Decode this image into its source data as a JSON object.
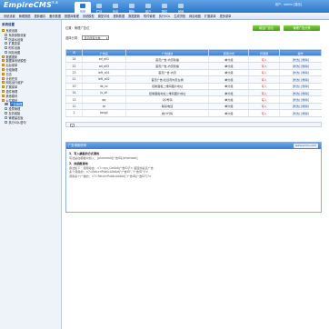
{
  "header": {
    "logo": "EmpireCMS",
    "version": "7.5",
    "user_line": "用户：admin [退出]",
    "tabs": [
      "系统",
      "栏目",
      "信息",
      "模板",
      "用户",
      "插件",
      "其他"
    ],
    "active_tab": 0
  },
  "subnav": [
    "系统设置",
    "管理数据",
    "更新缓存",
    "备份数据",
    "数据库管理",
    "系统模型",
    "模型字段",
    "更新数据",
    "数据更新",
    "附件管理",
    "执行SQL",
    "生成拼音",
    "网站地图",
    "扩展菜单",
    "更多菜单"
  ],
  "sidebar": {
    "title": "系统设置",
    "items": [
      {
        "label": "系统设置",
        "level": 0,
        "icon": "folder-icon"
      },
      {
        "label": "系统参数设置",
        "level": 1,
        "icon": "doc-icon"
      },
      {
        "label": "防灌水设置",
        "level": 1,
        "icon": "doc-icon"
      },
      {
        "label": "扩展变量",
        "level": 1,
        "icon": "doc-icon"
      },
      {
        "label": "附件设置",
        "level": 1,
        "icon": "doc-icon"
      },
      {
        "label": "网站地图",
        "level": 1,
        "icon": "doc-icon"
      },
      {
        "label": "数据更新",
        "level": 0,
        "icon": "folder-icon"
      },
      {
        "label": "数据库系统模型",
        "level": 0,
        "icon": "folder-icon"
      },
      {
        "label": "后台菜单",
        "level": 0,
        "icon": "folder-icon"
      },
      {
        "label": "分组管理",
        "level": 0,
        "icon": "folder-icon"
      },
      {
        "label": "日志",
        "level": 0,
        "icon": "folder-icon"
      },
      {
        "label": "计划任务",
        "level": 0,
        "icon": "folder-icon"
      },
      {
        "label": "网站运行维护",
        "level": 0,
        "icon": "folder-icon"
      },
      {
        "label": "扩展菜单",
        "level": 0,
        "icon": "folder-icon"
      },
      {
        "label": "插件管理",
        "level": 0,
        "icon": "folder-icon"
      },
      {
        "label": "其他模块",
        "level": 0,
        "icon": "folder-icon"
      },
      {
        "label": "公共模块",
        "level": 0,
        "icon": "folder-icon"
      },
      {
        "label": "广告管理",
        "level": 1,
        "icon": "doc-icon",
        "selected": true
      },
      {
        "label": "投票管理",
        "level": 1,
        "icon": "doc-icon"
      },
      {
        "label": "友情链接",
        "level": 1,
        "icon": "doc-icon"
      },
      {
        "label": "管理留言板",
        "level": 1,
        "icon": "doc-icon"
      },
      {
        "label": "执行SQL语句",
        "level": 1,
        "icon": "doc-icon"
      }
    ]
  },
  "page": {
    "breadcrumb": "位置：管理广告位",
    "add_button": "增加广告位",
    "manage_button": "管理广告分类",
    "filter_label": "选择分类：",
    "filter_value": "显示所有分类"
  },
  "table": {
    "headers": [
      "ID",
      "广告名",
      "广告描述",
      "调用方式",
      "JS调用",
      "操作"
    ],
    "rows": [
      [
        "24",
        "ad_a01",
        "首页广告-内页轮播",
        "单分组",
        "写入",
        "[修改] [删除]"
      ],
      [
        "22",
        "ad_a03",
        "首页广告-内页轮播",
        "单分组",
        "写入",
        "[修改] [删除]"
      ],
      [
        "23",
        "left_a01",
        "首页广告-内页",
        "单分组",
        "写入",
        "[修改] [删除]"
      ],
      [
        "21",
        "left_a02",
        "首页广告-栏目页内页左侧",
        "单分组",
        "写入",
        "[修改] [删除]"
      ],
      [
        "20",
        "ds_vv",
        "控制面板二维码图片地址",
        "单分组",
        "写入",
        "[修改] [删除]"
      ],
      [
        "14",
        "js_zh",
        "控制面板地址二维码图片地址",
        "单分组",
        "写入",
        "[修改] [删除]"
      ],
      [
        "13",
        "qq",
        "QQ号码",
        "单分组",
        "写入",
        "[修改] [删除]"
      ],
      [
        "12",
        "qr",
        "联系电话",
        "单分组",
        "写入",
        "[修改] [删除]"
      ],
      [
        "1",
        "tongji",
        "统计代码",
        "单分组",
        "写入",
        "[修改] [删除]"
      ]
    ]
  },
  "pager": "1",
  "note": {
    "title": "广告调用说明",
    "brand": "www.ecms.com",
    "h1": "1、写入模板的方式调用",
    "t1": "写法是在模板中加入：[phomead]广告ID[/phomead]",
    "h2": "2、用函数调用",
    "t2": "用法如下：调用动态：<?=sys_GetAd(广告ID)?> 返回的是该广告",
    "t3": "多个调用的：<?=ReturnPublicAddAd(\"广告ID\",\"广告ID\")?>",
    "t4": "调用多个广告的：<?=ReturnPublicAddAd(\"广告ID|广告ID\")?>"
  }
}
